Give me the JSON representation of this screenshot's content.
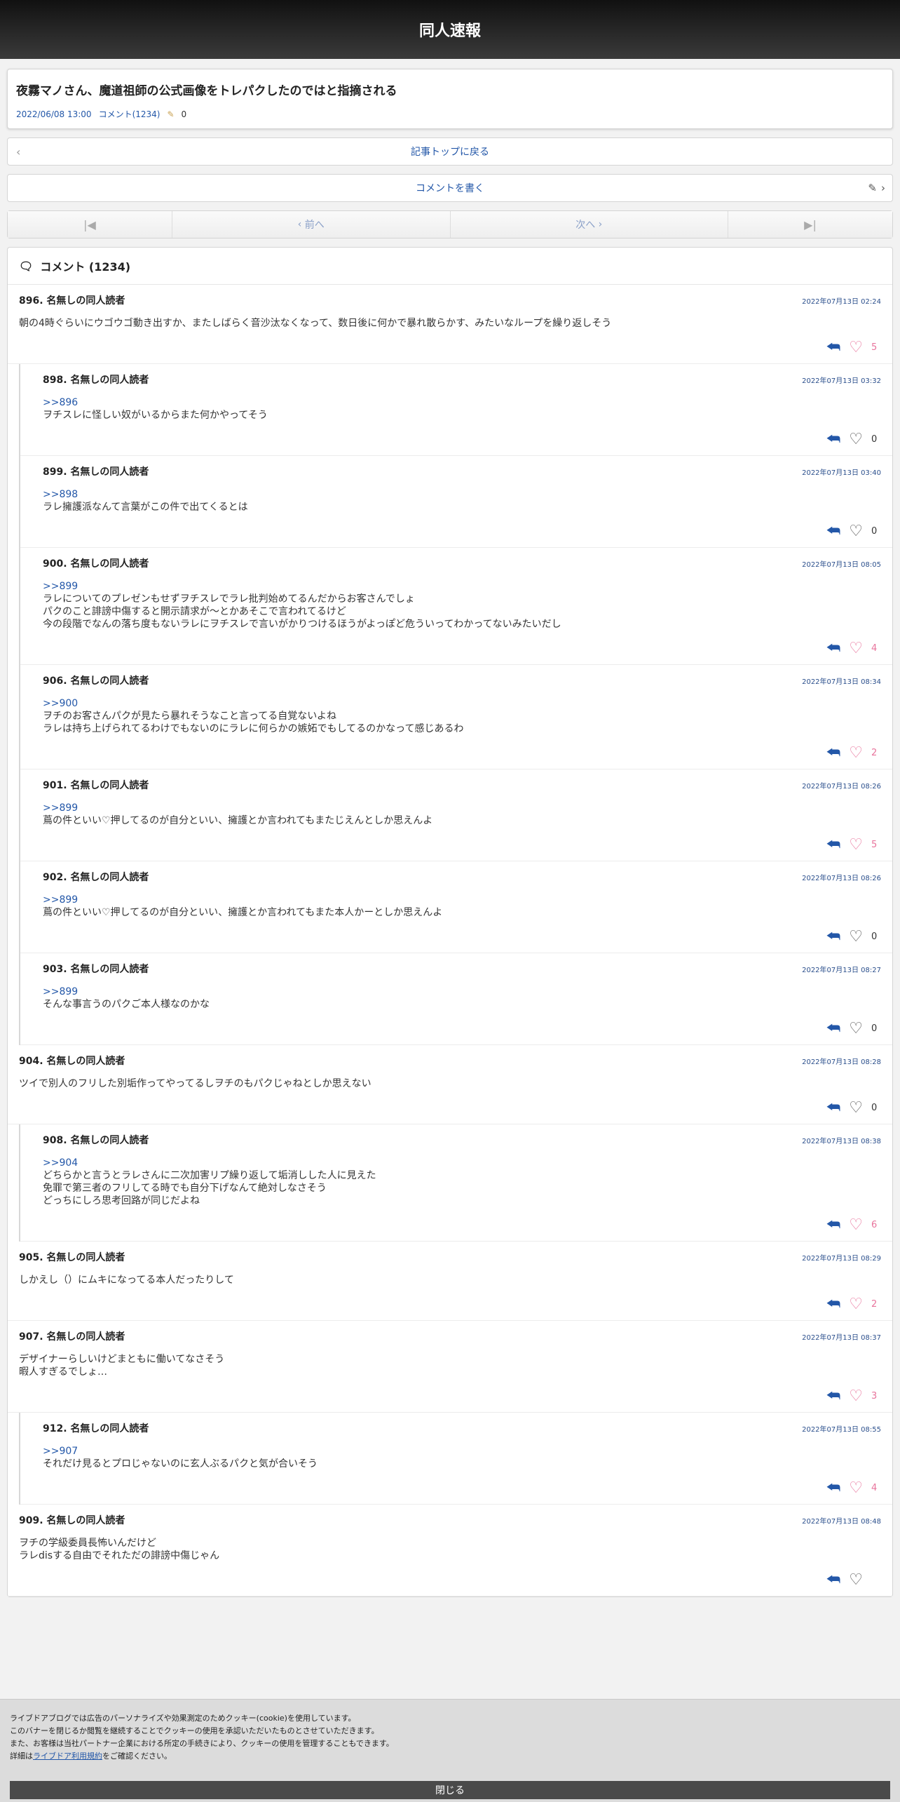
{
  "header": {
    "site_title": "同人速報"
  },
  "article": {
    "title": "夜霧マノさん、魔道祖師の公式画像をトレパクしたのではと指摘される",
    "date": "2022/06/08 13:00",
    "comment_link": "コメント(1234)",
    "pencil_count": "0"
  },
  "nav": {
    "back_label": "記事トップに戻る",
    "write_label": "コメントを書く"
  },
  "pager": {
    "first": "|◀",
    "prev": "前へ",
    "next": "次へ",
    "last": "▶|"
  },
  "comments_header": "コメント (1234)",
  "comments": [
    {
      "num": "896.",
      "name": "名無しの同人読者",
      "date": "2022年07月13日 02:24",
      "anchor": "",
      "body": "朝の4時ぐらいにウゴウゴ動き出すか、またしばらく音沙汰なくなって、数日後に何かで暴れ散らかす、みたいなループを繰り返しそう",
      "likes": "5",
      "liked": true,
      "replies": [
        {
          "num": "898.",
          "name": "名無しの同人読者",
          "date": "2022年07月13日 03:32",
          "anchor": ">>896",
          "body": "ヲチスレに怪しい奴がいるからまた何かやってそう",
          "likes": "0",
          "liked": false
        },
        {
          "num": "899.",
          "name": "名無しの同人読者",
          "date": "2022年07月13日 03:40",
          "anchor": ">>898",
          "body": "ラレ擁護派なんて言葉がこの件で出てくるとは",
          "likes": "0",
          "liked": false
        },
        {
          "num": "900.",
          "name": "名無しの同人読者",
          "date": "2022年07月13日 08:05",
          "anchor": ">>899",
          "body": "ラレについてのプレゼンもせずヲチスレでラレ批判始めてるんだからお客さんでしょ\nパクのこと誹謗中傷すると開示請求が〜とかあそこで言われてるけど\n今の段階でなんの落ち度もないラレにヲチスレで言いがかりつけるほうがよっぽど危ういってわかってないみたいだし",
          "likes": "4",
          "liked": true
        },
        {
          "num": "906.",
          "name": "名無しの同人読者",
          "date": "2022年07月13日 08:34",
          "anchor": ">>900",
          "body": "ヲチのお客さんパクが見たら暴れそうなこと言ってる自覚ないよね\nラレは持ち上げられてるわけでもないのにラレに何らかの嫉妬でもしてるのかなって感じあるわ",
          "likes": "2",
          "liked": true
        },
        {
          "num": "901.",
          "name": "名無しの同人読者",
          "date": "2022年07月13日 08:26",
          "anchor": ">>899",
          "body": "蔦の件といい♡押してるのが自分といい、擁護とか言われてもまたじえんとしか思えんよ",
          "likes": "5",
          "liked": true
        },
        {
          "num": "902.",
          "name": "名無しの同人読者",
          "date": "2022年07月13日 08:26",
          "anchor": ">>899",
          "body": "蔦の件といい♡押してるのが自分といい、擁護とか言われてもまた本人かーとしか思えんよ",
          "likes": "0",
          "liked": false
        },
        {
          "num": "903.",
          "name": "名無しの同人読者",
          "date": "2022年07月13日 08:27",
          "anchor": ">>899",
          "body": "そんな事言うのパクご本人様なのかな",
          "likes": "0",
          "liked": false
        }
      ]
    },
    {
      "num": "904.",
      "name": "名無しの同人読者",
      "date": "2022年07月13日 08:28",
      "anchor": "",
      "body": "ツイで別人のフリした別垢作ってやってるしヲチのもパクじゃねとしか思えない",
      "likes": "0",
      "liked": false,
      "replies": [
        {
          "num": "908.",
          "name": "名無しの同人読者",
          "date": "2022年07月13日 08:38",
          "anchor": ">>904",
          "body": "どちらかと言うとラレさんに二次加害リプ繰り返して垢消しした人に見えた\n免罪で第三者のフリしてる時でも自分下げなんて絶対しなさそう\nどっちにしろ思考回路が同じだよね",
          "likes": "6",
          "liked": true
        }
      ]
    },
    {
      "num": "905.",
      "name": "名無しの同人読者",
      "date": "2022年07月13日 08:29",
      "anchor": "",
      "body": "しかえし（）にムキになってる本人だったりして",
      "likes": "2",
      "liked": true,
      "replies": []
    },
    {
      "num": "907.",
      "name": "名無しの同人読者",
      "date": "2022年07月13日 08:37",
      "anchor": "",
      "body": "デザイナーらしいけどまともに働いてなさそう\n暇人すぎるでしょ…",
      "likes": "3",
      "liked": true,
      "replies": [
        {
          "num": "912.",
          "name": "名無しの同人読者",
          "date": "2022年07月13日 08:55",
          "anchor": ">>907",
          "body": "それだけ見るとプロじゃないのに玄人ぶるパクと気が合いそう",
          "likes": "4",
          "liked": true
        }
      ]
    },
    {
      "num": "909.",
      "name": "名無しの同人読者",
      "date": "2022年07月13日 08:48",
      "anchor": "",
      "body": "ヲチの学級委員長怖いんだけど\nラレdisする自由でそれただの誹謗中傷じゃん",
      "likes": "",
      "liked": false,
      "replies": []
    }
  ],
  "cookie": {
    "line1": "ライブドアブログでは広告のパーソナライズや効果測定のためクッキー(cookie)を使用しています。",
    "line2": "このバナーを閉じるか閲覧を継続することでクッキーの使用を承認いただいたものとさせていただきます。",
    "line3": "また、お客様は当社パートナー企業における所定の手続きにより、クッキーの使用を管理することもできます。",
    "line4_pre": "詳細は",
    "line4_link": "ライブドア利用規約",
    "line4_post": "をご確認ください。",
    "close_label": "閉じる"
  }
}
